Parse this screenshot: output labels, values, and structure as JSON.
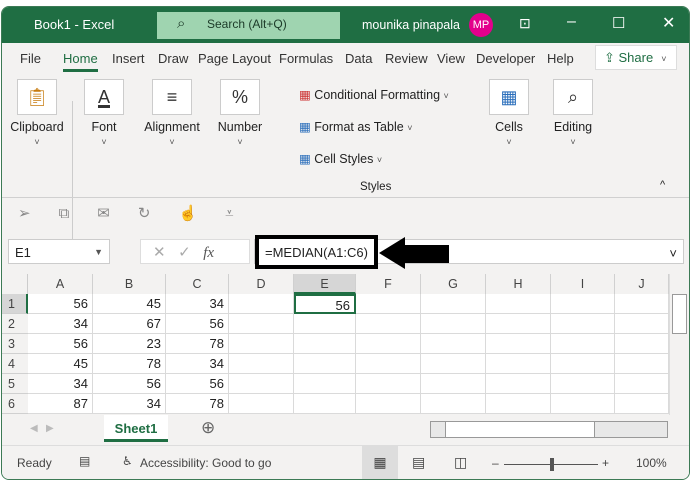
{
  "title": {
    "doc": "Book1  -  Excel",
    "search": "Search (Alt+Q)",
    "user": "mounika pinapala",
    "initials": "MP"
  },
  "tabs": [
    "File",
    "Home",
    "Insert",
    "Draw",
    "Page Layout",
    "Formulas",
    "Data",
    "Review",
    "View",
    "Developer",
    "Help"
  ],
  "share": "Share",
  "ribbon": {
    "clipboard": "Clipboard",
    "font": "Font",
    "alignment": "Alignment",
    "number": "Number",
    "cond": "Conditional Formatting",
    "fat": "Format as Table",
    "cstyles": "Cell Styles",
    "styles": "Styles",
    "cells": "Cells",
    "editing": "Editing"
  },
  "formula": {
    "namebox": "E1",
    "fx": "fx",
    "value": "=MEDIAN(A1:C6)"
  },
  "columns": [
    "A",
    "B",
    "C",
    "D",
    "E",
    "F",
    "G",
    "H",
    "I",
    "J"
  ],
  "rows": [
    [
      "56",
      "45",
      "34"
    ],
    [
      "34",
      "67",
      "56"
    ],
    [
      "56",
      "23",
      "78"
    ],
    [
      "45",
      "78",
      "34"
    ],
    [
      "34",
      "56",
      "56"
    ],
    [
      "87",
      "34",
      "78"
    ]
  ],
  "e1": "56",
  "sheet": "Sheet1",
  "status": {
    "ready": "Ready",
    "access": "Accessibility: Good to go",
    "zoom": "100%"
  },
  "colors": {
    "green": "#1f6e43",
    "accent": "#e3008c"
  }
}
